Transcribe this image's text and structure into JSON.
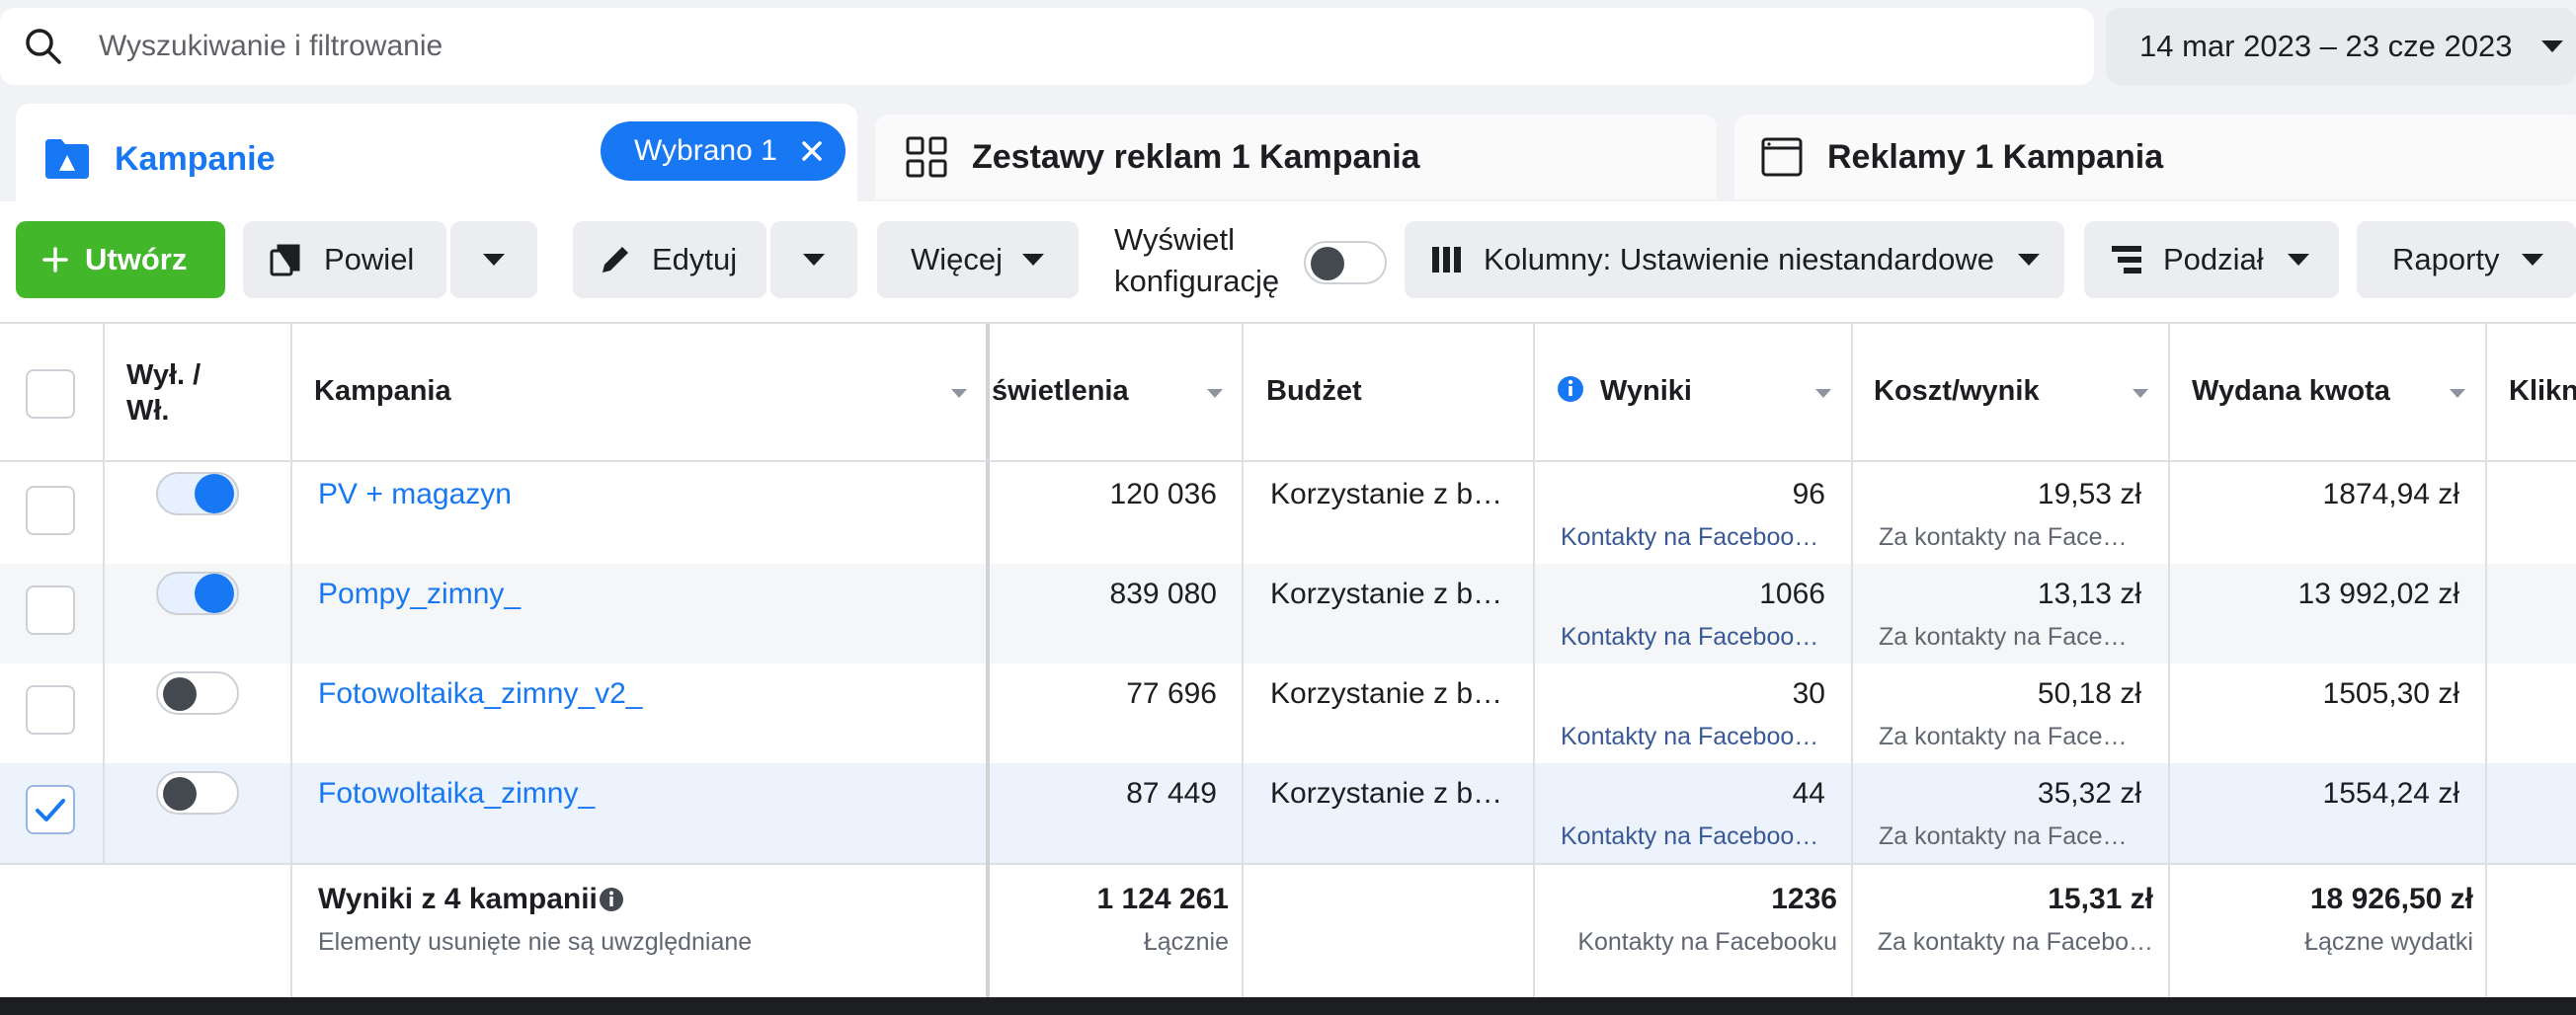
{
  "search": {
    "placeholder": "Wyszukiwanie i filtrowanie"
  },
  "date_range": "14 mar 2023 – 23 cze 2023",
  "tabs": {
    "campaigns": {
      "label": "Kampanie",
      "chip": "Wybrano 1"
    },
    "adsets": {
      "label": "Zestawy reklam 1 Kampania"
    },
    "ads": {
      "label": "Reklamy 1 Kampania"
    }
  },
  "toolbar": {
    "create": "Utwórz",
    "duplicate": "Powiel",
    "edit": "Edytuj",
    "more": "Więcej",
    "view_config_line1": "Wyświetl",
    "view_config_line2": "konfigurację",
    "columns": "Kolumny: Ustawienie niestandardowe",
    "breakdown": "Podział",
    "reports": "Raporty"
  },
  "table": {
    "headers": {
      "onoff_line1": "Wył. /",
      "onoff_line2": "Wł.",
      "campaign": "Kampania",
      "impressions": "świetlenia",
      "budget": "Budżet",
      "results": "Wyniki",
      "cost_per_result": "Koszt/wynik",
      "amount_spent": "Wydana kwota",
      "clicks": "Klikn"
    },
    "rows": [
      {
        "name": "PV + magazyn",
        "on": true,
        "selected": false,
        "impressions": "120 036",
        "budget": "Korzystanie z b…",
        "results": "96",
        "results_type": "Kontakty na Faceboo…",
        "cost": "19,53 zł",
        "cost_type": "Za kontakty na Face…",
        "spent": "1874,94 zł"
      },
      {
        "name": "Pompy_zimny_",
        "on": true,
        "selected": false,
        "impressions": "839 080",
        "budget": "Korzystanie z b…",
        "results": "1066",
        "results_type": "Kontakty na Faceboo…",
        "cost": "13,13 zł",
        "cost_type": "Za kontakty na Face…",
        "spent": "13 992,02 zł"
      },
      {
        "name": "Fotowoltaika_zimny_v2_",
        "on": false,
        "selected": false,
        "impressions": "77 696",
        "budget": "Korzystanie z b…",
        "results": "30",
        "results_type": "Kontakty na Faceboo…",
        "cost": "50,18 zł",
        "cost_type": "Za kontakty na Face…",
        "spent": "1505,30 zł"
      },
      {
        "name": "Fotowoltaika_zimny_",
        "on": false,
        "selected": true,
        "impressions": "87 449",
        "budget": "Korzystanie z b…",
        "results": "44",
        "results_type": "Kontakty na Faceboo…",
        "cost": "35,32 zł",
        "cost_type": "Za kontakty na Face…",
        "spent": "1554,24 zł"
      }
    ],
    "footer": {
      "title": "Wyniki z 4 kampanii",
      "note": "Elementy usunięte nie są uwzględniane",
      "impressions": "1 124 261",
      "impressions_sub": "Łącznie",
      "results": "1236",
      "results_sub": "Kontakty na Facebooku",
      "cost": "15,31 zł",
      "cost_sub": "Za kontakty na Facebo…",
      "spent": "18 926,50 zł",
      "spent_sub": "Łączne wydatki"
    }
  },
  "colors": {
    "accent": "#1877f2",
    "create": "#42b72a"
  }
}
